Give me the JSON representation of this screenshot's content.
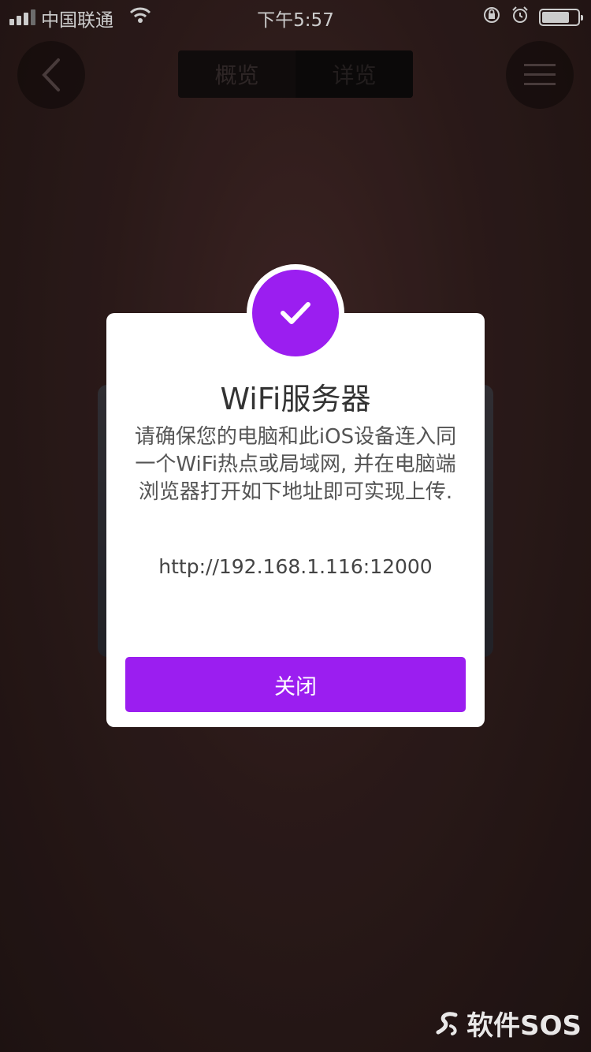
{
  "status_bar": {
    "carrier": "中国联通",
    "time": "下午5:57"
  },
  "nav": {
    "tabs": [
      "概览",
      "详览"
    ]
  },
  "dialog": {
    "title": "WiFi服务器",
    "message": "请确保您的电脑和此iOS设备连入同一个WiFi热点或局域网, 并在电脑端浏览器打开如下地址即可实现上传.",
    "url": "http://192.168.1.116:12000",
    "close_label": "关闭",
    "icon": "checkmark-icon"
  },
  "watermark": {
    "text": "软件SOS"
  },
  "colors": {
    "accent": "#9b1ef0",
    "background": "#35201f",
    "dialog_bg": "#ffffff"
  }
}
